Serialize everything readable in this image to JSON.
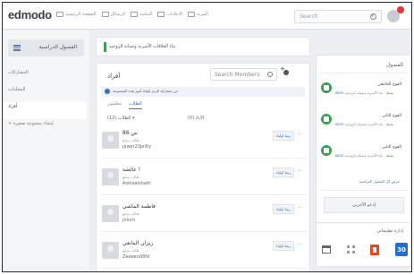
{
  "brand": {
    "logo": "edmodo"
  },
  "topnav": {
    "links": [
      "الصفحة الرئيسية",
      "الرسائل",
      "المكتبة",
      "الاعلانات",
      "المزيد"
    ],
    "search_placeholder": "Search"
  },
  "sidebar": {
    "groups_button": "الفصول الدراسية",
    "items": [
      {
        "label": "المشاركات"
      },
      {
        "label": "المجلدات"
      },
      {
        "label": "أفراد"
      },
      {
        "label": "+ إنشاء مجموعة صغيرة"
      }
    ]
  },
  "class_header": {
    "title": "بناء العلاقات الأسرية وصيانة الزوجية"
  },
  "members": {
    "title": "أفراد",
    "search_placeholder": "Search Members",
    "info_text": "من مشاركة الرمز أولياء أمور هذه المجموعة",
    "tabs": [
      {
        "label": "الطلاب",
        "active": true
      },
      {
        "label": "معلمون",
        "active": false
      }
    ],
    "sort_label": "الطلاب (12) ▾",
    "count_label": "(0) الآباء",
    "list": [
      {
        "name": "86 س",
        "role": "طالب سابع",
        "username": "jawer23jeilty",
        "button": "ربط أولياء"
      },
      {
        "name": "عائشة !",
        "role": "طالب سابع",
        "username": "Aishaaishatii",
        "button": "ربط أولياء"
      },
      {
        "name": "فاطمة الماشي",
        "role": "طالب سابع",
        "username": "jnlum",
        "button": "ربط أولياء"
      },
      {
        "name": "زيزان المانعي",
        "role": "طالب سابع",
        "username": "Zeeeen08fd",
        "button": "ربط أولياء"
      }
    ]
  },
  "right": {
    "title": "الفصول",
    "classes": [
      {
        "name": "الفوج الجامعي",
        "sub": "بناء الأسرية وصيانة الزوجية",
        "code": "6630",
        "status": "نشط"
      },
      {
        "name": "الفوج الثاني",
        "sub": "بناء الأسرية وصيانة الزوجية",
        "code": "6630",
        "status": "نشط"
      },
      {
        "name": "الفوج الثاني",
        "sub": "بناء الأسرية وصيانة الزوجية",
        "code": "6630",
        "status": "نشط"
      }
    ],
    "all_link": "عرض كل الفصول الدراسية",
    "join_button": "إدعو الآخرين",
    "apps_title": "إدارة تطبيقاتي",
    "calendar_day": "30"
  },
  "colors": {
    "accent": "#3a6fc4",
    "green": "#3f9d52",
    "notif": "#e53935"
  }
}
